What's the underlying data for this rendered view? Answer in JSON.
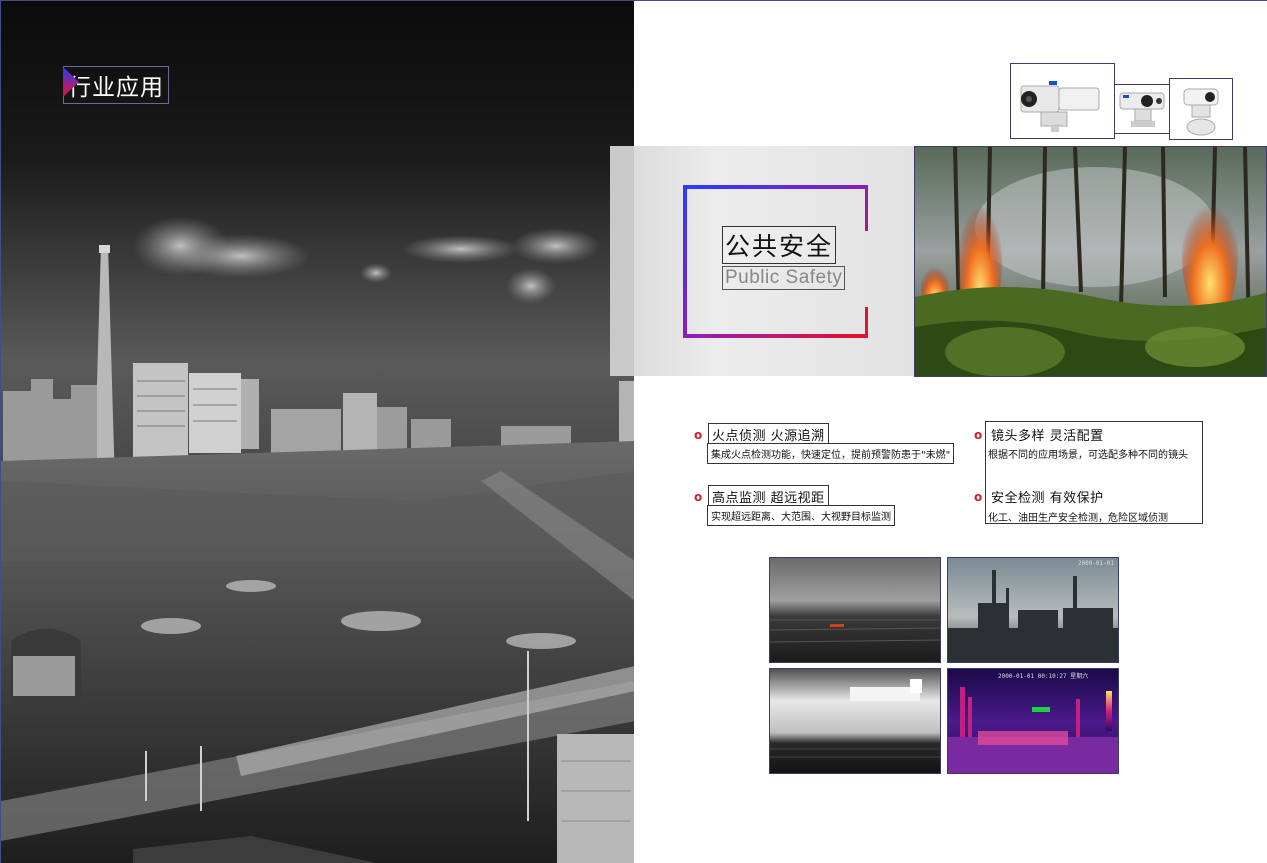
{
  "section": {
    "title": "行业应用"
  },
  "banner": {
    "title_cn": "公共安全",
    "title_en": "Public Safety"
  },
  "features": [
    {
      "bullet": "o",
      "title": "火点侦测  火源追溯",
      "desc": "集成火点检测功能，快速定位，提前预警防患于\"未燃\""
    },
    {
      "bullet": "o",
      "title": "高点监测  超远视距",
      "desc": "实现超远距离、大范围、大视野目标监测"
    },
    {
      "bullet": "o",
      "title": "镜头多样  灵活配置",
      "desc": "根据不同的应用场景，可选配多种不同的镜头"
    },
    {
      "bullet": "o",
      "title": "安全检测  有效保护",
      "desc": "化工、油田生产安全检测，危险区域侦测"
    }
  ],
  "thumbnails": {
    "industrial_timestamp": "2000-01-01",
    "thermal_timestamp": "2000-01-01 00:10:27 星期六"
  },
  "colors": {
    "accent_start": "#2b3bff",
    "accent_mid": "#8a1fb8",
    "accent_end": "#e8102a",
    "bullet": "#d0202a"
  }
}
